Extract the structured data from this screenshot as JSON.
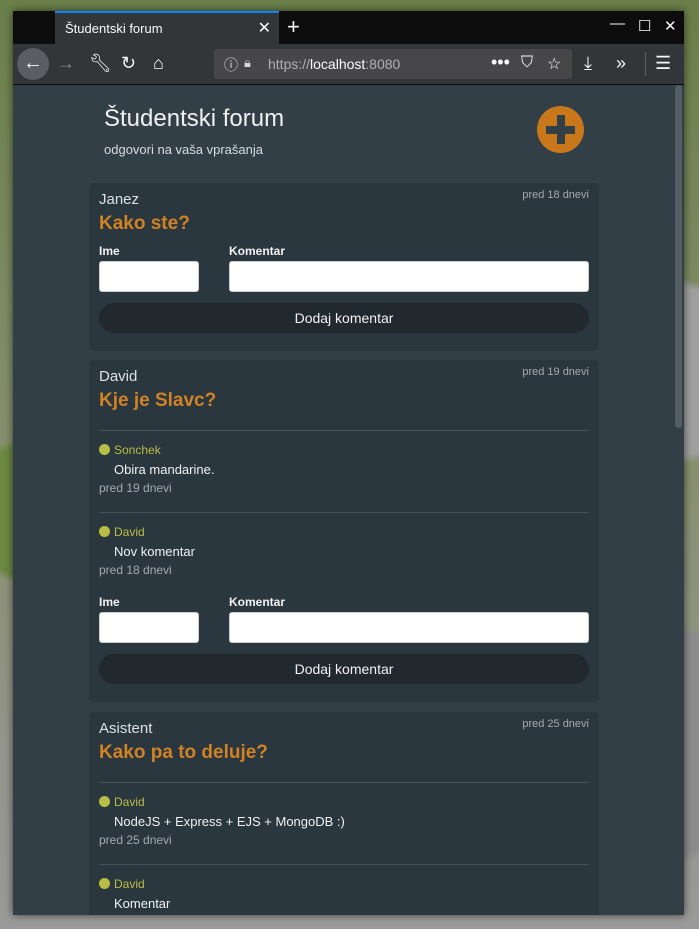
{
  "browser": {
    "tab_title": "Študentski forum",
    "url_protocol": "https://",
    "url_host": "localhost",
    "url_port": ":8080"
  },
  "page": {
    "title": "Študentski forum",
    "subtitle": "odgovori na vaša vprašanja"
  },
  "form": {
    "name_label": "Ime",
    "comment_label": "Komentar",
    "submit_label": "Dodaj komentar"
  },
  "posts": [
    {
      "author": "Janez",
      "time": "pred 18 dnevi",
      "question": "Kako ste?",
      "comments": []
    },
    {
      "author": "David",
      "time": "pred 19 dnevi",
      "question": "Kje je Slavc?",
      "comments": [
        {
          "author": "Sonchek",
          "text": "Obira mandarine.",
          "time": "pred 19 dnevi"
        },
        {
          "author": "David",
          "text": "Nov komentar",
          "time": "pred 18 dnevi"
        }
      ]
    },
    {
      "author": "Asistent",
      "time": "pred 25 dnevi",
      "question": "Kako pa to deluje?",
      "comments": [
        {
          "author": "David",
          "text": "NodeJS + Express + EJS + MongoDB :)",
          "time": "pred 25 dnevi"
        },
        {
          "author": "David",
          "text": "Komentar",
          "time": ""
        }
      ]
    }
  ]
}
